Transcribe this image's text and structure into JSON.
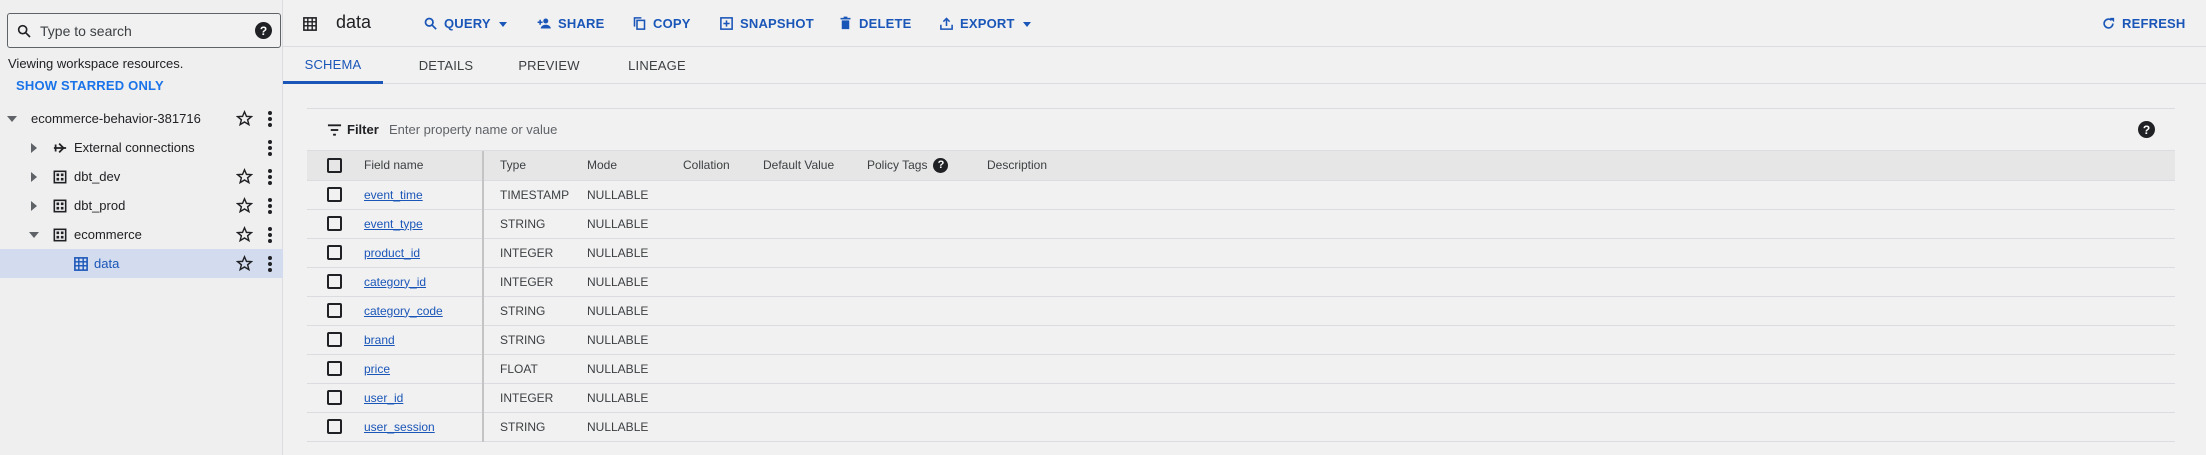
{
  "search": {
    "placeholder": "Type to search"
  },
  "explorer": {
    "viewing_text": "Viewing workspace resources.",
    "show_starred_label": "SHOW STARRED ONLY",
    "project": "ecommerce-behavior-381716",
    "items": [
      {
        "label": "External connections"
      },
      {
        "label": "dbt_dev"
      },
      {
        "label": "dbt_prod"
      },
      {
        "label": "ecommerce"
      },
      {
        "label": "data"
      }
    ]
  },
  "header": {
    "title": "data",
    "buttons": {
      "query": "QUERY",
      "share": "SHARE",
      "copy": "COPY",
      "snapshot": "SNAPSHOT",
      "delete": "DELETE",
      "export": "EXPORT",
      "refresh": "REFRESH"
    }
  },
  "tabs": [
    {
      "label": "SCHEMA"
    },
    {
      "label": "DETAILS"
    },
    {
      "label": "PREVIEW"
    },
    {
      "label": "LINEAGE"
    }
  ],
  "filter": {
    "label": "Filter",
    "placeholder": "Enter property name or value"
  },
  "table": {
    "columns": {
      "field_name": "Field name",
      "type": "Type",
      "mode": "Mode",
      "collation": "Collation",
      "default_value": "Default Value",
      "policy_tags": "Policy Tags",
      "description": "Description"
    },
    "rows": [
      {
        "name": "event_time",
        "type": "TIMESTAMP",
        "mode": "NULLABLE"
      },
      {
        "name": "event_type",
        "type": "STRING",
        "mode": "NULLABLE"
      },
      {
        "name": "product_id",
        "type": "INTEGER",
        "mode": "NULLABLE"
      },
      {
        "name": "category_id",
        "type": "INTEGER",
        "mode": "NULLABLE"
      },
      {
        "name": "category_code",
        "type": "STRING",
        "mode": "NULLABLE"
      },
      {
        "name": "brand",
        "type": "STRING",
        "mode": "NULLABLE"
      },
      {
        "name": "price",
        "type": "FLOAT",
        "mode": "NULLABLE"
      },
      {
        "name": "user_id",
        "type": "INTEGER",
        "mode": "NULLABLE"
      },
      {
        "name": "user_session",
        "type": "STRING",
        "mode": "NULLABLE"
      }
    ]
  },
  "help_glyph": "?",
  "colors": {
    "accent": "#1a56b8",
    "selected_row": "#d3dcee"
  }
}
